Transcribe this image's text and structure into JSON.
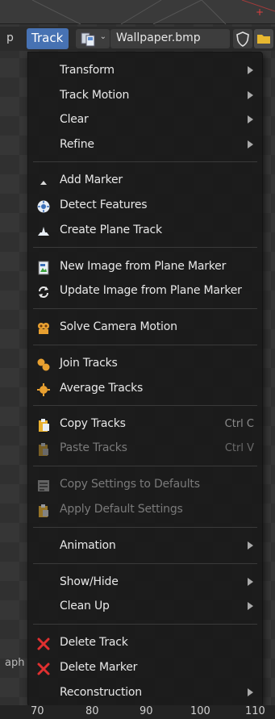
{
  "header": {
    "prev_menu_fragment": "p",
    "track_menu": "Track",
    "image_name": "Wallpaper.bmp"
  },
  "menu": {
    "transform": "Transform",
    "track_motion": "Track Motion",
    "clear": "Clear",
    "refine": "Refine",
    "add_marker": "Add Marker",
    "detect_features": "Detect Features",
    "create_plane_track": "Create Plane Track",
    "new_image_from_plane_marker": "New Image from Plane Marker",
    "update_image_from_plane_marker": "Update Image from Plane Marker",
    "solve_camera_motion": "Solve Camera Motion",
    "join_tracks": "Join Tracks",
    "average_tracks": "Average Tracks",
    "copy_tracks": "Copy Tracks",
    "copy_tracks_shortcut": "Ctrl C",
    "paste_tracks": "Paste Tracks",
    "paste_tracks_shortcut": "Ctrl V",
    "copy_settings_to_defaults": "Copy Settings to Defaults",
    "apply_default_settings": "Apply Default Settings",
    "animation": "Animation",
    "show_hide": "Show/Hide",
    "clean_up": "Clean Up",
    "delete_track": "Delete Track",
    "delete_marker": "Delete Marker",
    "reconstruction": "Reconstruction"
  },
  "left_strip": {
    "fragment": "aph"
  },
  "ruler": {
    "ticks": [
      "70",
      "80",
      "90",
      "100",
      "110"
    ]
  },
  "colors": {
    "accent": "#4772b3",
    "delete_red": "#e03030",
    "icon_orange": "#e8a030"
  },
  "icons": {
    "add_marker": "triangle-up-icon",
    "detect_features": "detect-features-icon",
    "create_plane_track": "plane-track-icon",
    "new_image": "image-icon",
    "update_image": "refresh-icon",
    "solve_camera": "camera-solve-icon",
    "join_tracks": "join-tracks-icon",
    "average_tracks": "average-tracks-icon",
    "copy_tracks": "clipboard-copy-icon",
    "paste_tracks": "clipboard-paste-icon",
    "copy_settings": "preset-icon",
    "apply_settings": "clipboard-paste-icon",
    "delete": "x-icon"
  }
}
